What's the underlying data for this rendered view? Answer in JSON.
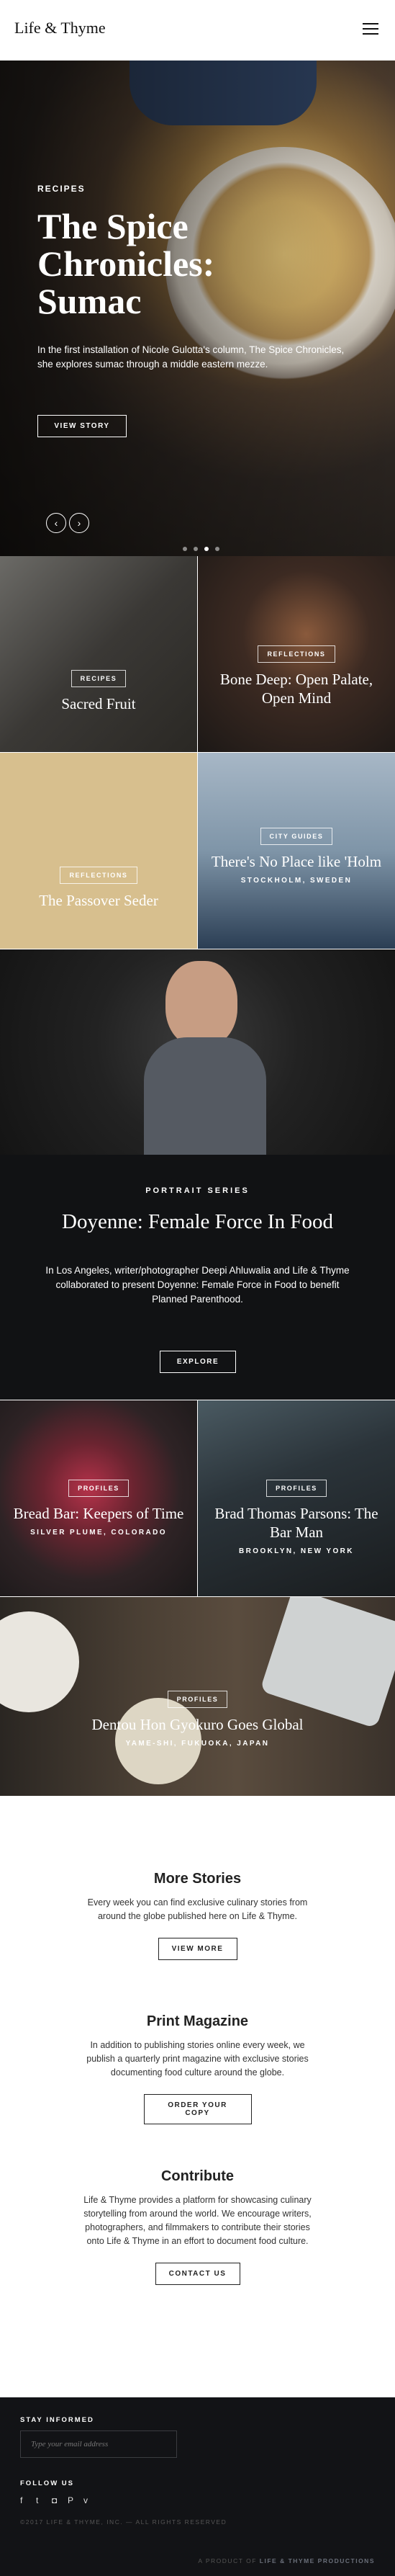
{
  "header": {
    "logo": "Life & Thyme",
    "menu_icon": "hamburger-menu-icon"
  },
  "hero": {
    "eyebrow": "RECIPES",
    "title": "The Spice Chronicles: Sumac",
    "description": "In the first installation of Nicole Gulotta's column, The Spice Chronicles, she explores sumac through a middle eastern mezze.",
    "button": "VIEW STORY",
    "prev_icon": "arrow-left-icon",
    "next_icon": "arrow-right-icon",
    "prev_glyph": "‹",
    "next_glyph": "›",
    "active_slide": 3,
    "slide_count": 4
  },
  "tiles_top": [
    {
      "tag": "RECIPES",
      "title": "Sacred Fruit",
      "location": ""
    },
    {
      "tag": "REFLECTIONS",
      "title": "Bone Deep: Open Palate, Open Mind",
      "location": ""
    },
    {
      "tag": "REFLECTIONS",
      "title": "The Passover Seder",
      "location": ""
    },
    {
      "tag": "CITY GUIDES",
      "title": "There's No Place like 'Holm",
      "location": "STOCKHOLM, SWEDEN"
    }
  ],
  "portrait": {
    "eyebrow": "PORTRAIT SERIES",
    "title": "Doyenne: Female Force In Food",
    "description": "In Los Angeles, writer/photographer Deepi Ahluwalia and Life & Thyme collaborated to present Doyenne: Female Force in Food to benefit Planned Parenthood.",
    "button": "EXPLORE"
  },
  "tiles_bottom": [
    {
      "tag": "PROFILES",
      "title": "Bread Bar: Keepers of Time",
      "location": "SILVER PLUME, COLORADO"
    },
    {
      "tag": "PROFILES",
      "title": "Brad Thomas Parsons: The Bar Man",
      "location": "BROOKLYN, NEW YORK"
    },
    {
      "tag": "PROFILES",
      "title": "Dentou Hon Gyokuro Goes Global",
      "location": "YAME-SHI, FUKUOKA, JAPAN"
    }
  ],
  "more_stories": {
    "title": "More Stories",
    "text": "Every week you can find exclusive culinary stories from around the globe published here on Life & Thyme.",
    "button": "VIEW MORE"
  },
  "print_magazine": {
    "title": "Print Magazine",
    "text": "In addition to publishing stories online every week, we publish a quarterly print magazine with exclusive stories documenting food culture around the globe.",
    "button": "ORDER YOUR COPY"
  },
  "contribute": {
    "title": "Contribute",
    "text": "Life & Thyme provides a platform for showcasing culinary storytelling from around the world. We encourage writers, photographers, and filmmakers to contribute their stories onto Life & Thyme in an effort to document food culture.",
    "button": "CONTACT US"
  },
  "footer": {
    "stay_label": "STAY INFORMED",
    "email_placeholder": "Type your email address",
    "follow_label": "FOLLOW US",
    "social": [
      {
        "icon": "facebook-icon",
        "glyph": "f"
      },
      {
        "icon": "twitter-icon",
        "glyph": "t"
      },
      {
        "icon": "instagram-icon",
        "glyph": "◘"
      },
      {
        "icon": "pinterest-icon",
        "glyph": "P"
      },
      {
        "icon": "vimeo-icon",
        "glyph": "v"
      }
    ],
    "copyright": "©2017 LIFE & THYME, INC. — ALL RIGHTS RESERVED",
    "product_prefix": "A PRODUCT OF",
    "product_name": "LIFE & THYME PRODUCTIONS"
  },
  "colors": {
    "dark_section": "#111214",
    "footer": "#121316",
    "accent_footer_link": "#6a6f7a"
  }
}
